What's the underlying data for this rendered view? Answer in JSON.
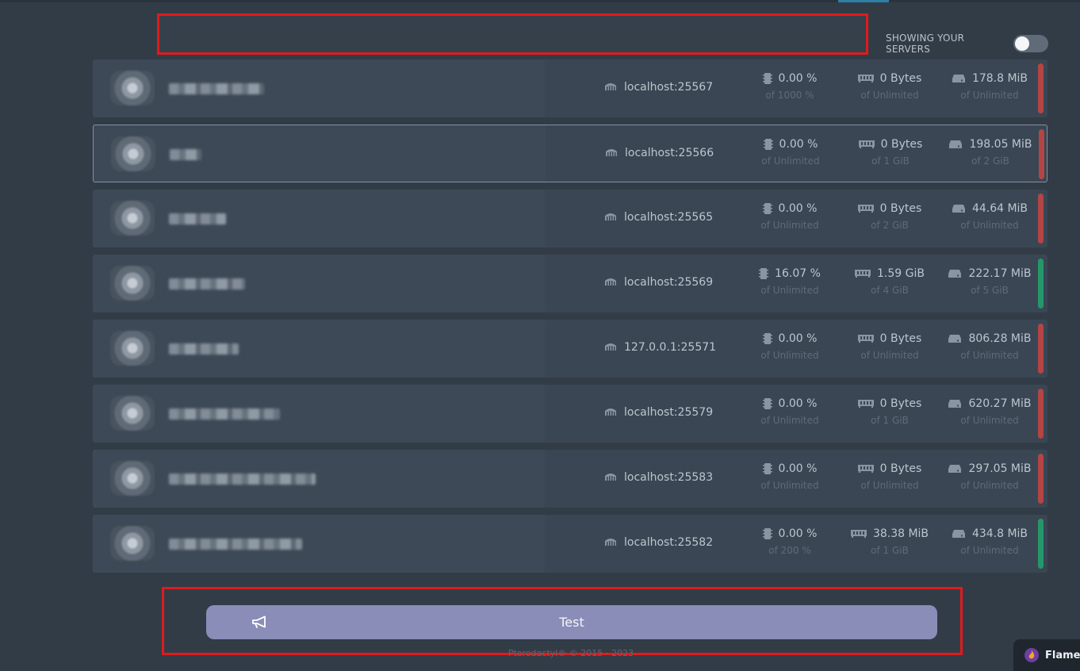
{
  "header": {
    "toggle_label": "SHOWING YOUR SERVERS",
    "toggle_on": false
  },
  "servers": [
    {
      "address": "localhost:25567",
      "cpu": "0.00 %",
      "cpu_limit": "of 1000 %",
      "memory": "0 Bytes",
      "memory_limit": "of Unlimited",
      "disk": "178.8 MiB",
      "disk_limit": "of Unlimited",
      "status": "off"
    },
    {
      "address": "localhost:25566",
      "cpu": "0.00 %",
      "cpu_limit": "of Unlimited",
      "memory": "0 Bytes",
      "memory_limit": "of 1 GiB",
      "disk": "198.05 MiB",
      "disk_limit": "of 2 GiB",
      "status": "off"
    },
    {
      "address": "localhost:25565",
      "cpu": "0.00 %",
      "cpu_limit": "of Unlimited",
      "memory": "0 Bytes",
      "memory_limit": "of 2 GiB",
      "disk": "44.64 MiB",
      "disk_limit": "of Unlimited",
      "status": "off"
    },
    {
      "address": "localhost:25569",
      "cpu": "16.07 %",
      "cpu_limit": "of Unlimited",
      "memory": "1.59 GiB",
      "memory_limit": "of 4 GiB",
      "disk": "222.17 MiB",
      "disk_limit": "of 5 GiB",
      "status": "on"
    },
    {
      "address": "127.0.0.1:25571",
      "cpu": "0.00 %",
      "cpu_limit": "of Unlimited",
      "memory": "0 Bytes",
      "memory_limit": "of Unlimited",
      "disk": "806.28 MiB",
      "disk_limit": "of Unlimited",
      "status": "off"
    },
    {
      "address": "localhost:25579",
      "cpu": "0.00 %",
      "cpu_limit": "of Unlimited",
      "memory": "0 Bytes",
      "memory_limit": "of 1 GiB",
      "disk": "620.27 MiB",
      "disk_limit": "of Unlimited",
      "status": "off"
    },
    {
      "address": "localhost:25583",
      "cpu": "0.00 %",
      "cpu_limit": "of Unlimited",
      "memory": "0 Bytes",
      "memory_limit": "of Unlimited",
      "disk": "297.05 MiB",
      "disk_limit": "of Unlimited",
      "status": "off"
    },
    {
      "address": "localhost:25582",
      "cpu": "0.00 %",
      "cpu_limit": "of 200 %",
      "memory": "38.38 MiB",
      "memory_limit": "of 1 GiB",
      "disk": "434.8 MiB",
      "disk_limit": "of Unlimited",
      "status": "on"
    }
  ],
  "announcement": {
    "text": "Test",
    "icon": "megaphone-icon"
  },
  "footer": {
    "text": "Pterodactyl® © 2015 - 2023"
  },
  "badge": {
    "text": "Flame",
    "icon": "flame-icon"
  },
  "colors": {
    "status_off": "#b34545",
    "status_on": "#26966a",
    "announcement_bg": "#8a8db8"
  }
}
